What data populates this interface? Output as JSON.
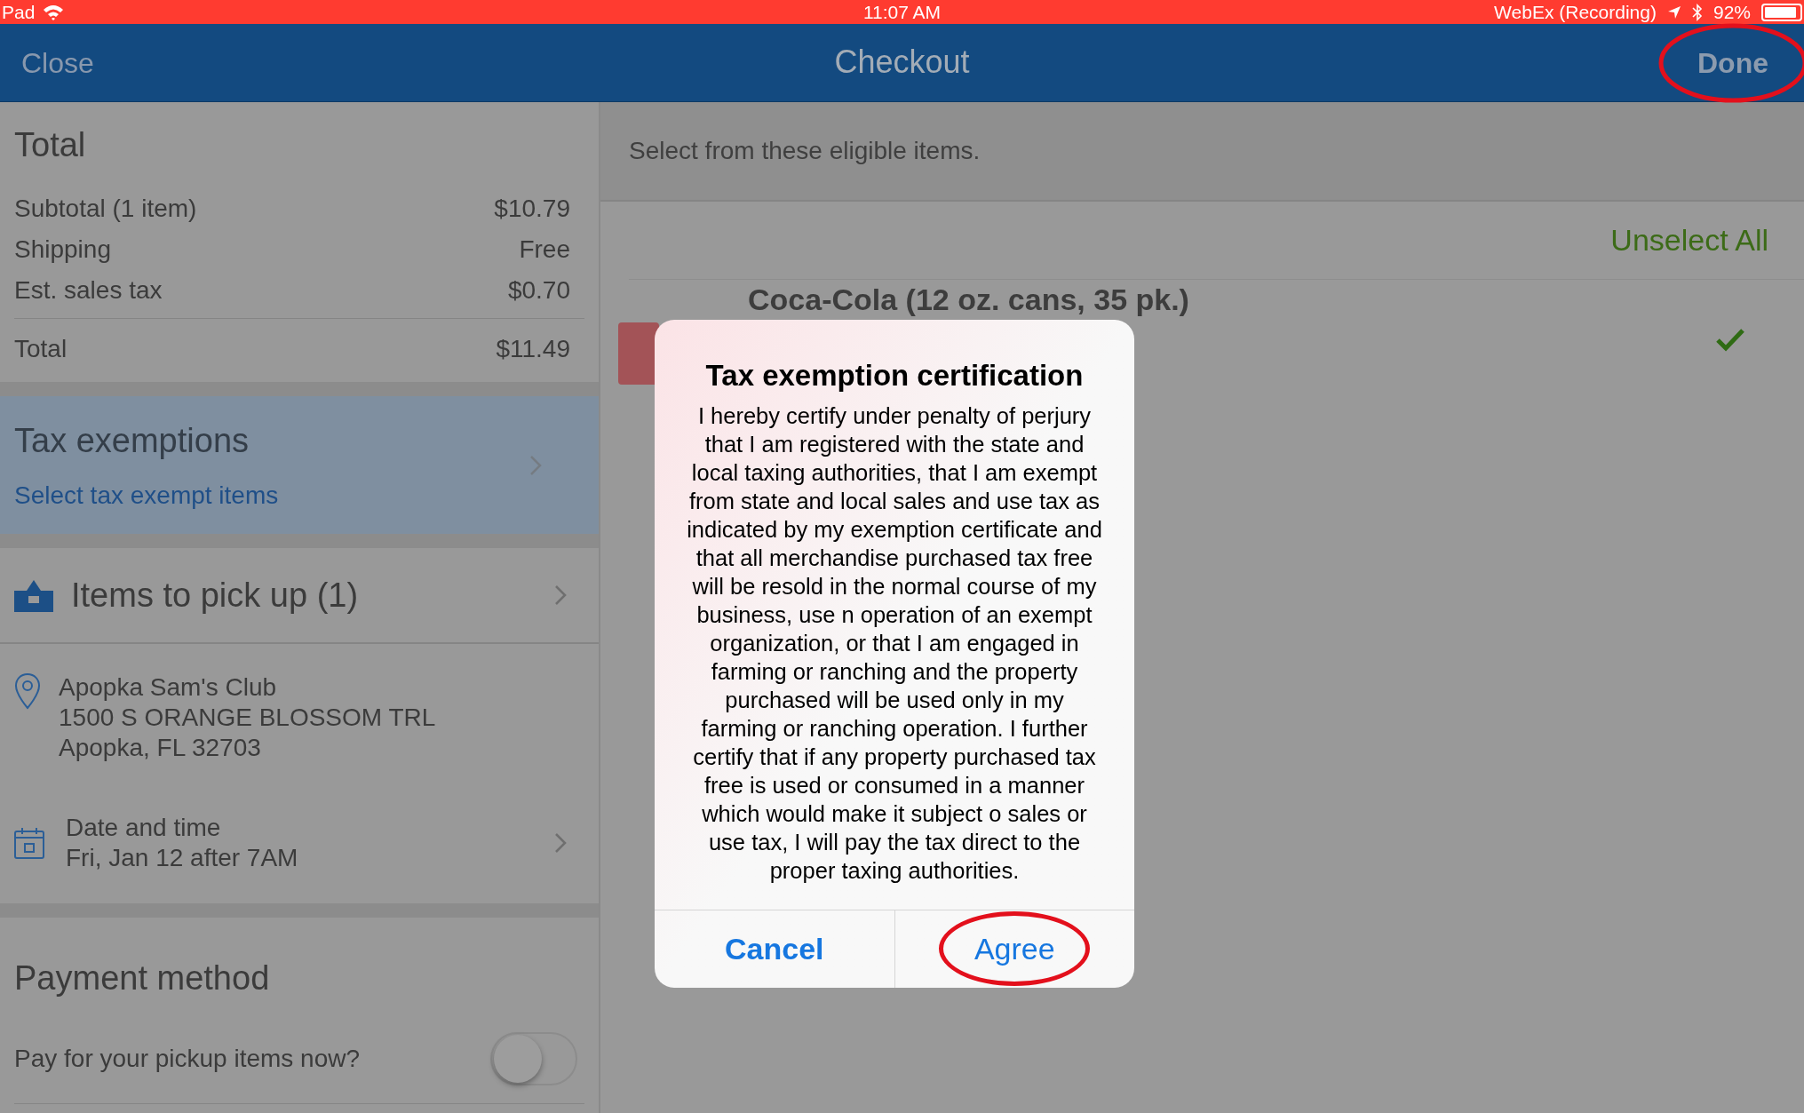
{
  "status_bar": {
    "carrier": "Pad",
    "time": "11:07 AM",
    "recording": "WebEx (Recording)",
    "battery": "92%"
  },
  "nav": {
    "close": "Close",
    "title": "Checkout",
    "done": "Done"
  },
  "total": {
    "heading": "Total",
    "rows": [
      {
        "label": "Subtotal (1 item)",
        "value": "$10.79"
      },
      {
        "label": "Shipping",
        "value": "Free"
      },
      {
        "label": "Est. sales tax",
        "value": "$0.70"
      }
    ],
    "grand": {
      "label": "Total",
      "value": "$11.49"
    }
  },
  "tax_exemptions": {
    "title": "Tax exemptions",
    "link": "Select tax exempt items"
  },
  "pickup": {
    "title": "Items to pick up (1)",
    "store": {
      "name": "Apopka Sam's Club",
      "address": [
        "1500 S ORANGE BLOSSOM TRL",
        "Apopka, FL 32703"
      ]
    },
    "date": {
      "label": "Date and time",
      "value": "Fri, Jan 12 after 7AM"
    }
  },
  "payment": {
    "heading": "Payment method",
    "toggle": {
      "label": "Pay for your pickup items now?",
      "on": false
    }
  },
  "items_panel": {
    "prompt": "Select from these eligible items.",
    "unselect_all": "Unselect All",
    "items": [
      {
        "name": "Coca-Cola (12 oz. cans, 35 pk.)",
        "checked": true
      }
    ]
  },
  "dialog": {
    "title": "Tax exemption certification",
    "body": "I hereby certify under penalty of perjury that I am registered with the state and local taxing authorities, that I am exempt from state and local sales and use tax as indicated by my exemption certificate and that all merchandise purchased tax free will be resold in the normal course of my business, use n operation of an exempt organization, or that I am engaged in farming or ranching and the property purchased will be used only in my farming or ranching operation. I further certify that if any property purchased tax free is used or consumed in a manner which would make it subject o sales or use tax, I will pay the tax direct to the proper taxing authorities.",
    "buttons": [
      {
        "label": "Cancel",
        "kind": "cancel",
        "circled": false
      },
      {
        "label": "Agree",
        "kind": "default",
        "circled": true
      }
    ]
  }
}
